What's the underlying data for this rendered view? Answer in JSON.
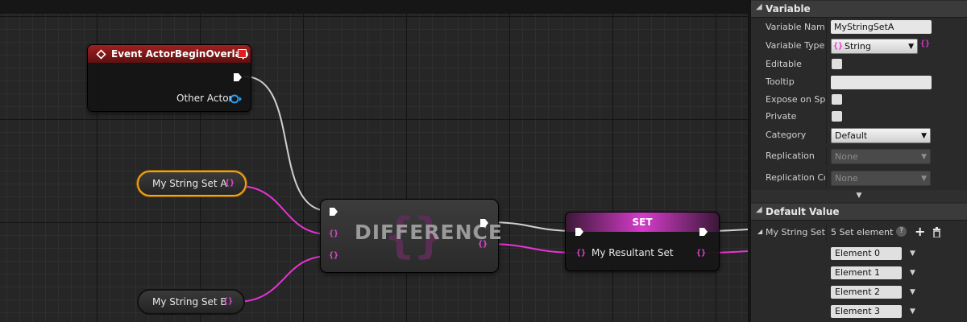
{
  "graph": {
    "event_node": {
      "title": "Event ActorBeginOverlap",
      "pin_label": "Other Actor",
      "header_color": "#a02020"
    },
    "getter_a": {
      "label": "My String Set A"
    },
    "getter_b": {
      "label": "My String Set B"
    },
    "difference_node": {
      "title": "DIFFERENCE"
    },
    "set_node": {
      "title": "SET",
      "pin_label": "My Resultant Set",
      "header_color": "#d63ccb"
    },
    "colors": {
      "exec_wire": "#d0d0d0",
      "set_wire": "#e832d6",
      "object_pin": "#1fa3ff",
      "selection": "#f0a21a"
    },
    "set_pin_glyph": "{}"
  },
  "details": {
    "variable_section": {
      "title": "Variable",
      "variable_name_label": "Variable Name",
      "variable_name_value": "MyStringSetA",
      "variable_type_label": "Variable Type",
      "variable_type_value": "String",
      "editable_label": "Editable",
      "tooltip_label": "Tooltip",
      "tooltip_value": "",
      "expose_label": "Expose on Spawn",
      "private_label": "Private",
      "category_label": "Category",
      "category_value": "Default",
      "replication_label": "Replication",
      "replication_value": "None",
      "replication_condition_label": "Replication Condition",
      "replication_condition_value": "None"
    },
    "default_value_section": {
      "title": "Default Value",
      "row_label": "My String Set",
      "count_text": "5 Set element",
      "elements": [
        "Element 0",
        "Element 1",
        "Element 2",
        "Element 3"
      ]
    }
  }
}
